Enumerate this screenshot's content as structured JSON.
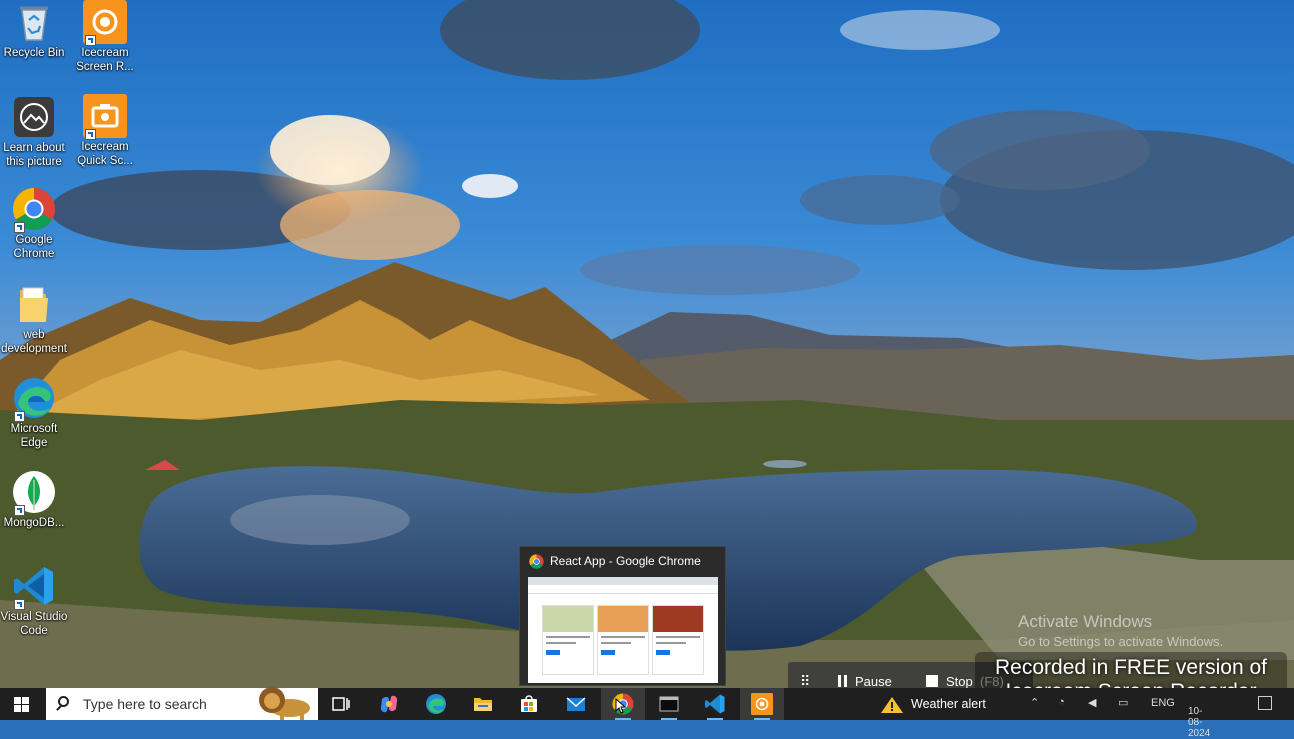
{
  "desktop": {
    "icons": [
      {
        "label": "Recycle Bin",
        "icon": "recycle-bin-icon"
      },
      {
        "label": "Icecream Screen R...",
        "icon": "icecream-screen-recorder-icon"
      },
      {
        "label": "Learn about this picture",
        "icon": "learn-about-picture-icon"
      },
      {
        "label": "Icecream Quick Sc...",
        "icon": "icecream-quick-screenshot-icon"
      },
      {
        "label": "Google Chrome",
        "icon": "chrome-icon"
      },
      {
        "label": "web development",
        "icon": "folder-icon"
      },
      {
        "label": "Microsoft Edge",
        "icon": "edge-icon"
      },
      {
        "label": "MongoDB...",
        "icon": "mongodb-icon"
      },
      {
        "label": "Visual Studio Code",
        "icon": "vscode-icon"
      }
    ]
  },
  "preview": {
    "title": "React App - Google Chrome"
  },
  "activate_windows": {
    "title": "Activate Windows",
    "subtitle": "Go to Settings to activate Windows."
  },
  "recorder": {
    "pause_label": "Pause",
    "stop_label": "Stop",
    "stop_key": "(F8)",
    "watermark_line1": "Recorded in FREE version of",
    "watermark_line2": "Icecream  Screen  Recorder"
  },
  "taskbar": {
    "search_placeholder": "Type here to search",
    "apps": [
      "task-view-icon",
      "copilot-icon",
      "edge-icon",
      "file-explorer-icon",
      "microsoft-store-icon",
      "mail-icon",
      "chrome-icon",
      "terminal-icon",
      "vscode-icon",
      "icecream-recorder-icon"
    ],
    "weather_text": "Weather alert",
    "language": "ENG",
    "date": "10-08-2024"
  },
  "colors": {
    "taskbar_bg": "#1f1f1f",
    "accent": "#6cb8f0",
    "icecream_orange": "#f7941d"
  }
}
